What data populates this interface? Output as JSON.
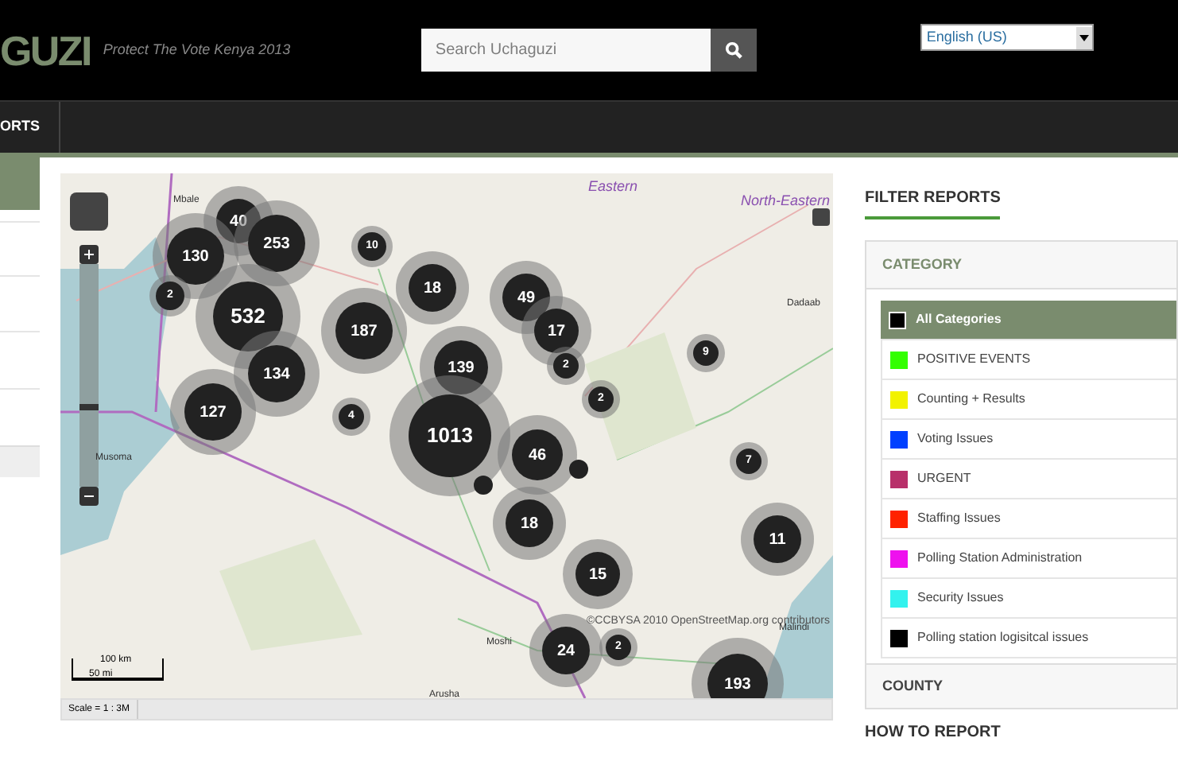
{
  "header": {
    "logo": "GUZI",
    "tagline": "Protect The Vote Kenya 2013",
    "search": {
      "placeholder": "Search Uchaguzi"
    },
    "language": "English (US)"
  },
  "nav": {
    "items": [
      {
        "label": "ORTS",
        "selected": false
      }
    ]
  },
  "map": {
    "zoom": {
      "level": 0.35
    },
    "places": [
      "Eastern",
      "North-Eastern",
      "Mbale",
      "Dadaab",
      "Musoma",
      "Arusha",
      "Moshi",
      "Malindi"
    ],
    "clusters": [
      "40",
      "130",
      "253",
      "10",
      "2",
      "532",
      "18",
      "49",
      "17",
      "187",
      "139",
      "2",
      "134",
      "9",
      "2",
      "127",
      "4",
      "1013",
      "46",
      "7",
      "18",
      "11",
      "15",
      "24",
      "2",
      "193"
    ],
    "attribution": "©CCBYSA 2010 OpenStreetMap.org contributors",
    "scale_km": "100 km",
    "scale_mi": "50 mi",
    "scale_text": "Scale = 1 : 3M"
  },
  "filter": {
    "title": "FILTER REPORTS",
    "category_heading": "CATEGORY",
    "categories": [
      {
        "label": "All Categories",
        "color": "#000000",
        "selected": true
      },
      {
        "label": "POSITIVE EVENTS",
        "color": "#33ff00",
        "selected": false
      },
      {
        "label": "Counting + Results",
        "color": "#f2f200",
        "selected": false
      },
      {
        "label": "Voting Issues",
        "color": "#0040ff",
        "selected": false
      },
      {
        "label": "URGENT",
        "color": "#b8306a",
        "selected": false
      },
      {
        "label": "Staffing Issues",
        "color": "#ff2200",
        "selected": false
      },
      {
        "label": "Polling Station Administration",
        "color": "#ee11ee",
        "selected": false
      },
      {
        "label": "Security Issues",
        "color": "#33f2ee",
        "selected": false
      },
      {
        "label": "Polling station logisitcal issues",
        "color": "#000000",
        "selected": false
      }
    ],
    "county_heading": "COUNTY",
    "how_to_report": "HOW TO REPORT"
  }
}
